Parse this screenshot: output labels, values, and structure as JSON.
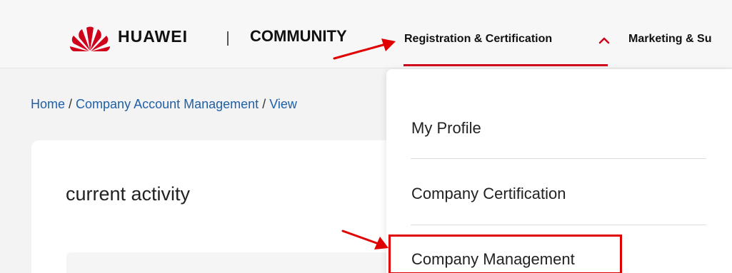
{
  "header": {
    "brand": "HUAWEI",
    "divider": "|",
    "community": "COMMUNITY",
    "nav": [
      {
        "label": "Registration & Certification"
      },
      {
        "label": "Marketing & Su"
      }
    ],
    "brand_color": "#d0021b"
  },
  "breadcrumb": {
    "items": [
      "Home",
      "Company Account Management",
      "View"
    ],
    "separator": " / "
  },
  "card": {
    "title": "current activity"
  },
  "dropdown": {
    "items": [
      {
        "label": "My Profile"
      },
      {
        "label": "Company Certification"
      },
      {
        "label": "Company Management"
      }
    ]
  },
  "annotation": {
    "arrow_color": "#e00000",
    "highlight_color": "#e00000"
  },
  "icons": {
    "logo": "huawei-logo-icon",
    "chevron": "chevron-up-icon",
    "arrows": "red-arrow-annotation"
  }
}
